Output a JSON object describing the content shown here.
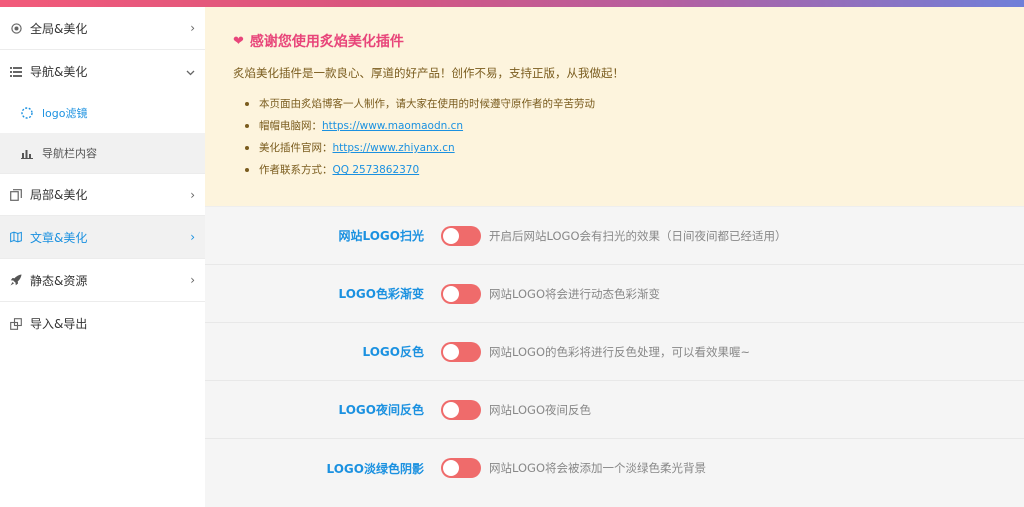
{
  "colors": {
    "accent": "#1b91e0",
    "toggle_off": "#ef6b6b",
    "notice_bg": "#fdf4dd",
    "title_pink": "#e8457a"
  },
  "sidebar": {
    "items": [
      {
        "label": "全局&美化",
        "icon": "circle-dot-icon"
      },
      {
        "label": "导航&美化",
        "icon": "list-icon"
      },
      {
        "label": "局部&美化",
        "icon": "copy-icon"
      },
      {
        "label": "文章&美化",
        "icon": "map-icon"
      },
      {
        "label": "静态&资源",
        "icon": "rocket-icon"
      },
      {
        "label": "导入&导出",
        "icon": "transfer-icon"
      }
    ],
    "sub_items": [
      {
        "label": "logo滤镜",
        "icon": "spinner-icon"
      },
      {
        "label": "导航栏内容",
        "icon": "bar-chart-icon"
      }
    ]
  },
  "notice": {
    "title": "感谢您使用炙焰美化插件",
    "desc": "炙焰美化插件是一款良心、厚道的好产品！创作不易，支持正版，从我做起！",
    "items": [
      {
        "text": "本页面由炙焰博客一人制作，请大家在使用的时候遵守原作者的辛苦劳动",
        "link": ""
      },
      {
        "text": "帽帽电脑网：",
        "link": "https://www.maomaodn.cn"
      },
      {
        "text": "美化插件官网：",
        "link": "https://www.zhiyanx.cn"
      },
      {
        "text": "作者联系方式：",
        "link": "QQ 2573862370"
      }
    ]
  },
  "settings": [
    {
      "label": "网站LOGO扫光",
      "desc": "开启后网站LOGO会有扫光的效果（日间夜间都已经适用）",
      "enabled": false
    },
    {
      "label": "LOGO色彩渐变",
      "desc": "网站LOGO将会进行动态色彩渐变",
      "enabled": false
    },
    {
      "label": "LOGO反色",
      "desc": "网站LOGO的色彩将进行反色处理，可以看效果喔~",
      "enabled": false
    },
    {
      "label": "LOGO夜间反色",
      "desc": "网站LOGO夜间反色",
      "enabled": false
    },
    {
      "label": "LOGO淡绿色阴影",
      "desc": "网站LOGO将会被添加一个淡绿色柔光背景",
      "enabled": false
    }
  ]
}
